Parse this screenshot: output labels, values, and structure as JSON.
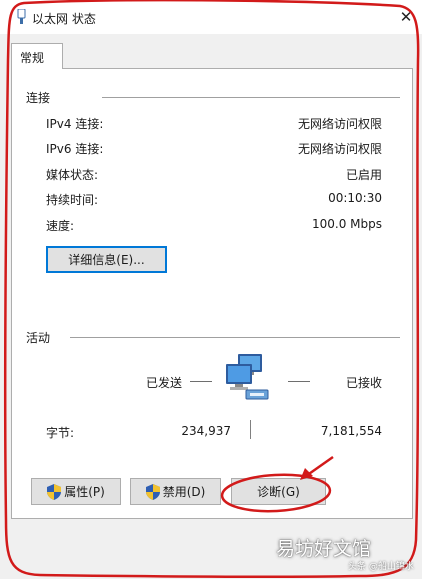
{
  "window": {
    "title": "以太网 状态",
    "close_glyph": "✕"
  },
  "tabs": [
    {
      "label": "常规",
      "active": true
    }
  ],
  "connection": {
    "heading": "连接",
    "rows": [
      {
        "label": "IPv4 连接:",
        "value": "无网络访问权限"
      },
      {
        "label": "IPv6 连接:",
        "value": "无网络访问权限"
      },
      {
        "label": "媒体状态:",
        "value": "已启用"
      },
      {
        "label": "持续时间:",
        "value": "00:10:30"
      },
      {
        "label": "速度:",
        "value": "100.0 Mbps"
      }
    ],
    "details_button": "详细信息(E)..."
  },
  "activity": {
    "heading": "活动",
    "sent_label": "已发送",
    "received_label": "已接收",
    "bytes_label": "字节:",
    "bytes_sent": "234,937",
    "bytes_received": "7,181,554",
    "icon": "network-computers-icon"
  },
  "buttons": {
    "properties": "属性(P)",
    "disable": "禁用(D)",
    "diagnose": "诊断(G)"
  },
  "watermark": {
    "main": "易坊好文馆",
    "small": "头条 @船山锦水"
  },
  "colors": {
    "annotation_red": "#d21a1a",
    "focus_blue": "#0078d7",
    "dialog_bg": "#f0f0f0"
  }
}
